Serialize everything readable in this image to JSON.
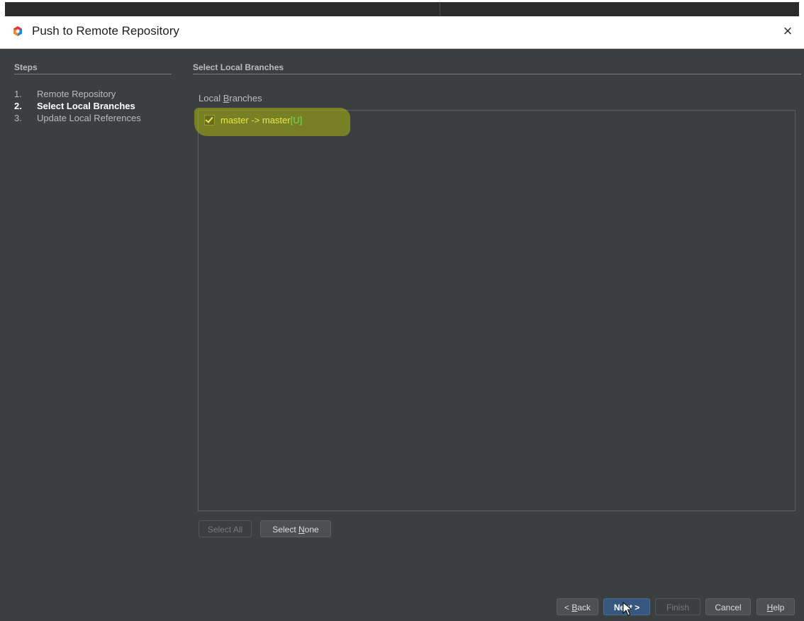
{
  "dialog": {
    "title": "Push to Remote Repository",
    "close_glyph": "×"
  },
  "steps": {
    "heading": "Steps",
    "items": [
      {
        "num": "1.",
        "label": "Remote Repository"
      },
      {
        "num": "2.",
        "label": "Select Local Branches"
      },
      {
        "num": "3.",
        "label": "Update Local References"
      }
    ],
    "current_index": 1
  },
  "main": {
    "heading": "Select Local Branches",
    "local_branches_label_prefix": "Local ",
    "local_branches_label_mnemonic": "B",
    "local_branches_label_suffix": "ranches",
    "branches": [
      {
        "text": "master -> master ",
        "tag": "[U]",
        "checked": true
      }
    ],
    "select_all_label": "Select All",
    "select_none_prefix": "Select ",
    "select_none_mnemonic": "N",
    "select_none_suffix": "one"
  },
  "footer": {
    "back_prefix": "< ",
    "back_mnemonic": "B",
    "back_suffix": "ack",
    "next_label": "Next >",
    "finish_label": "Finish",
    "cancel_label": "Cancel",
    "help_mnemonic": "H",
    "help_suffix": "elp"
  },
  "colors": {
    "accent_highlight": "#cedc00",
    "default_button": "#365880",
    "branch_text": "#e6e64a",
    "tag_text": "#7ed957"
  }
}
